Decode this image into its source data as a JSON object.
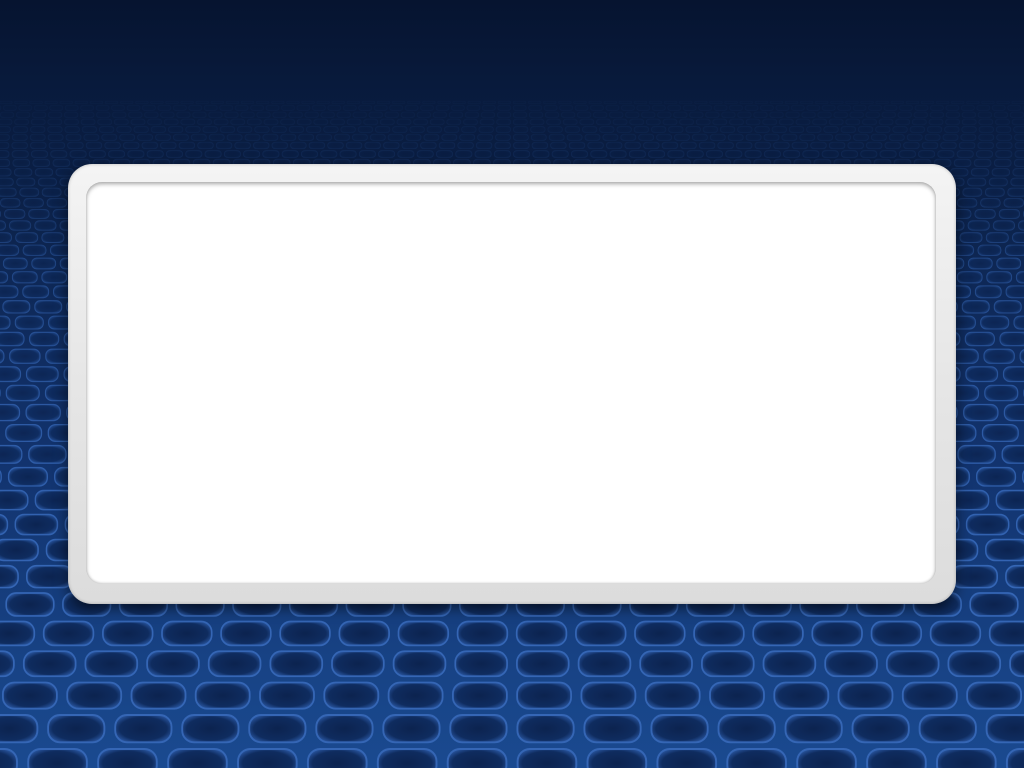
{
  "screen": {
    "background_color": "#0d2550",
    "grid_color": "#3a6cc0",
    "panel_color": "#ffffff",
    "panel_border_color": "#e6e6e6"
  }
}
